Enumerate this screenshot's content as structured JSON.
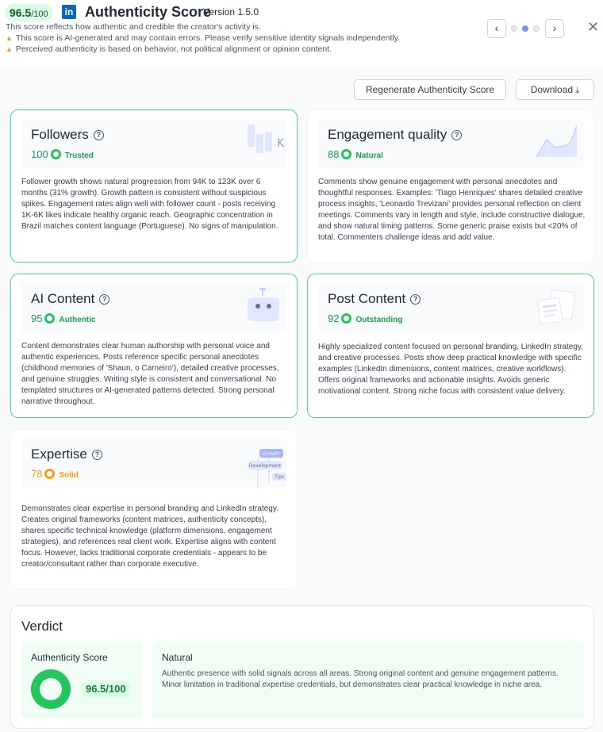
{
  "header": {
    "score": "96.5",
    "score_max": "/100",
    "logo": "in",
    "title": "Authenticity Score",
    "version": "Version 1.5.0",
    "description": "This score reflects how authentic and credible the creator's activity is.",
    "warnings": [
      "This score is AI-generated and may contain errors. Please verify sensitive identity signals independently.",
      "Perceived authenticity is based on behavior, not political alignment or opinion content."
    ],
    "nav": {
      "prev": "‹",
      "next": "›",
      "close": "✕",
      "pages": 3,
      "active_page": 2
    }
  },
  "actions": {
    "regenerate_label": "Regenerate Authenticity Score",
    "download_label": "Download"
  },
  "cards": [
    {
      "title": "Followers",
      "score": "100",
      "badge": "Trusted",
      "score_color": "#16a34a",
      "icon": "bar-chart-k-illustration",
      "text": "Follower growth shows natural progression from 94K to 123K over 6 months (31% growth). Growth pattern is consistent without suspicious spikes. Engagement rates align well with follower count - posts receiving 1K-6K likes indicate healthy organic reach. Geographic concentration in Brazil matches content language (Portuguese). No signs of manipulation."
    },
    {
      "title": "Engagement quality",
      "score": "88",
      "badge": "Natural",
      "score_color": "#16a34a",
      "icon": "area-chart-illustration",
      "text": "Comments show genuine engagement with personal anecdotes and thoughtful responses. Examples: 'Tiago Henriques' shares detailed creative process insights, 'Leonardo Trevizani' provides personal reflection on client meetings. Comments vary in length and style, include constructive dialogue, and show natural timing patterns. Some generic praise exists but <20% of total. Commenters challenge ideas and add value."
    },
    {
      "title": "AI Content",
      "score": "95",
      "badge": "Authentic",
      "score_color": "#16a34a",
      "icon": "robot-illustration",
      "text": "Content demonstrates clear human authorship with personal voice and authentic experiences. Posts reference specific personal anecdotes (childhood memories of 'Shaun, o Carneiro'), detailed creative processes, and genuine struggles. Writing style is consistent and conversational. No templated structures or AI-generated patterns detected. Strong personal narrative throughout."
    },
    {
      "title": "Post Content",
      "score": "92",
      "badge": "Outstanding",
      "score_color": "#16a34a",
      "icon": "documents-illustration",
      "text": "Highly specialized content focused on personal branding, LinkedIn strategy, and creative processes. Posts show deep practical knowledge with specific examples (LinkedIn dimensions, content matrices, creative workflows). Offers original frameworks and actionable insights. Avoids generic motivational content. Strong niche focus with consistent value delivery."
    },
    {
      "title": "Expertise",
      "score": "78",
      "badge": "Solid",
      "score_color": "#f59e0b",
      "icon": "tag-tree-illustration",
      "tags": [
        "Growth",
        "Development",
        "Tips"
      ],
      "text": "Demonstrates clear expertise in personal branding and LinkedIn strategy. Creates original frameworks (content matrices, authenticity concepts), shares specific technical knowledge (platform dimensions, engagement strategies), and references real client work. Expertise aligns with content focus. However, lacks traditional corporate credentials - appears to be creator/consultant rather than corporate executive."
    }
  ],
  "verdict": {
    "title": "Verdict",
    "score_label": "Authenticity Score",
    "score": "96.5/100",
    "score_fraction": 0.965,
    "kind": "Natural",
    "description": "Authentic presence with solid signals across all areas. Strong original content and genuine engagement patterns. Minor limitation in traditional expertise credentials, but demonstrates clear practical knowledge in niche area."
  }
}
